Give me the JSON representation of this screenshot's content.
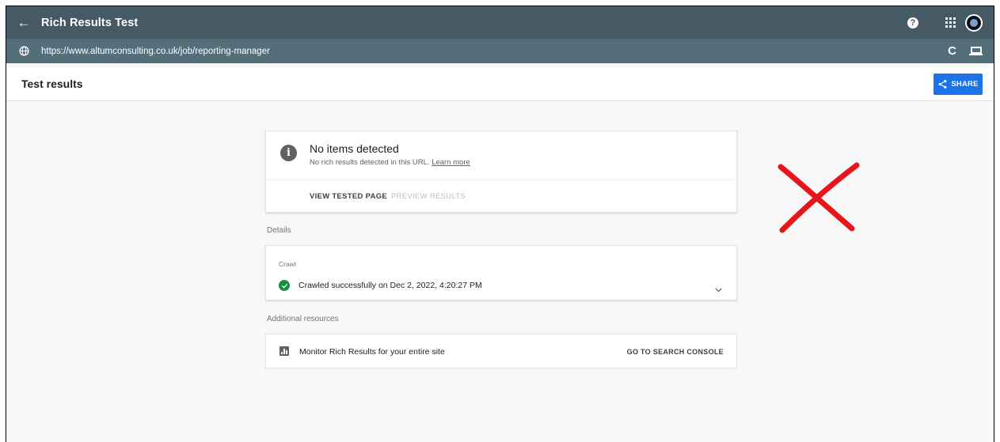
{
  "app": {
    "title": "Rich Results Test"
  },
  "url_bar": {
    "url": "https://www.altumconsulting.co.uk/job/reporting-manager"
  },
  "page_header": {
    "title": "Test results",
    "share_label": "SHARE"
  },
  "result_card": {
    "title": "No items detected",
    "subtitle": "No rich results detected in this URL.",
    "learn_more": "Learn more",
    "view_tested_page": "VIEW TESTED PAGE",
    "preview_results": "PREVIEW RESULTS"
  },
  "details": {
    "label": "Details",
    "crawl_label": "Crawl",
    "crawl_status": "Crawled successfully on Dec 2, 2022, 4:20:27 PM"
  },
  "additional": {
    "label": "Additional resources",
    "monitor_text": "Monitor Rich Results for your entire site",
    "go_to_console": "GO TO SEARCH CONSOLE"
  },
  "icons": {
    "back": "arrow-left-icon",
    "help": "help-icon",
    "apps": "apps-grid-icon",
    "globe": "globe-icon",
    "reload": "reload-icon",
    "device": "laptop-icon",
    "share": "share-icon",
    "info": "info-icon",
    "success": "check-circle-icon",
    "expand": "chevron-down-icon",
    "chart": "bar-chart-icon"
  },
  "colors": {
    "topbar": "#455a64",
    "urlbar": "#546e7a",
    "accent": "#1a73e8",
    "success": "#1e8e3e",
    "annotation": "#e8151a"
  }
}
